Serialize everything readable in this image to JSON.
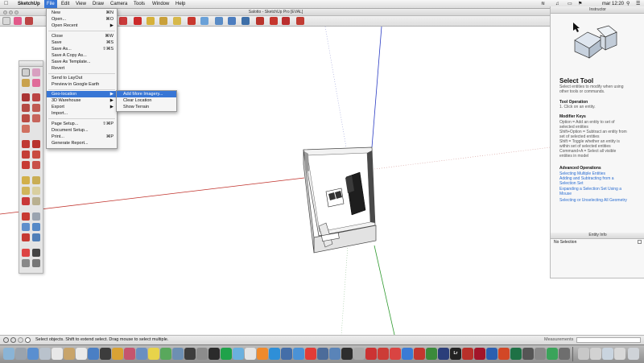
{
  "menubar": {
    "app_name": "SketchUp",
    "items": [
      "File",
      "Edit",
      "View",
      "Draw",
      "Camera",
      "Tools",
      "Window",
      "Help"
    ],
    "clock": "mar 12:20"
  },
  "window": {
    "title": "Salotto - SketchUp Pro [EVAL]"
  },
  "file_menu": {
    "items": [
      {
        "label": "New",
        "shortcut": "⌘N"
      },
      {
        "label": "Open...",
        "shortcut": "⌘O"
      },
      {
        "label": "Open Recent",
        "shortcut": "▶"
      },
      {
        "label": "Close",
        "shortcut": "⌘W"
      },
      {
        "label": "Save",
        "shortcut": "⌘S"
      },
      {
        "label": "Save As...",
        "shortcut": "⇧⌘S"
      },
      {
        "label": "Save A Copy As...",
        "shortcut": ""
      },
      {
        "label": "Save As Template...",
        "shortcut": ""
      },
      {
        "label": "Revert",
        "shortcut": ""
      },
      {
        "label": "Send to LayOut",
        "shortcut": ""
      },
      {
        "label": "Preview in Google Earth",
        "shortcut": ""
      },
      {
        "label": "Geo-location",
        "shortcut": "▶"
      },
      {
        "label": "3D Warehouse",
        "shortcut": "▶"
      },
      {
        "label": "Export",
        "shortcut": "▶"
      },
      {
        "label": "Import...",
        "shortcut": ""
      },
      {
        "label": "Page Setup...",
        "shortcut": "⇧⌘P"
      },
      {
        "label": "Document Setup...",
        "shortcut": ""
      },
      {
        "label": "Print...",
        "shortcut": "⌘P"
      },
      {
        "label": "Generate Report...",
        "shortcut": ""
      }
    ]
  },
  "geo_submenu": {
    "items": [
      "Add More Imagery...",
      "Clear Location",
      "Show Terrain"
    ]
  },
  "instructor": {
    "header": "Instructor",
    "tool_title": "Select Tool",
    "tool_desc_1": "Select entities to modify when using",
    "tool_desc_2": "other tools or commands.",
    "op_title": "Tool Operation",
    "op_1": "1.  Click on an entity.",
    "mod_title": "Modifier Keys",
    "mod_lines": [
      "Option = Add an entity to set of",
      "selected entities",
      "Shift+Option = Subtract an entity from",
      "set of selected entities",
      "Shift = Toggle whether an entity is",
      "within set of selected entities",
      "Command+A = Select all visible",
      "entities in model"
    ],
    "adv_title": "Advanced Operations",
    "adv_links": [
      "Selecting Multiple Entities",
      "Adding and Subtracting from a",
      "Selection Set",
      "Expanding a Selection Set Using a",
      "Mouse",
      "Selecting or Unselecting All Geometry"
    ]
  },
  "entity_info": {
    "header": "Entity Info",
    "selection": "No Selection"
  },
  "statusbar": {
    "message": "Select objects. Shift to extend select. Drag mouse to select multiple.",
    "measurements_label": "Measurements"
  },
  "colors": {
    "menu_highlight": "#3876d5",
    "axis_red": "#c0302a",
    "axis_green": "#2f9a2f",
    "axis_blue": "#2b3cc4",
    "link": "#2a6dd1"
  },
  "dock": {
    "lr_label": "Lr"
  }
}
